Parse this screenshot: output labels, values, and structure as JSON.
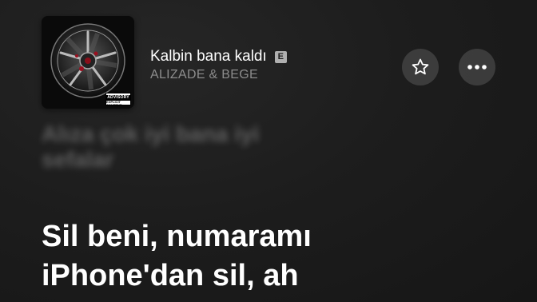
{
  "now_playing": {
    "title": "Kalbin bana kaldı",
    "explicit_badge": "E",
    "artist": "ALIZADE & BEGE",
    "artwork_advisory": {
      "top": "PARENTAL",
      "main": "ADVISORY",
      "bottom": "EXPLICIT CONTENT"
    }
  },
  "actions": {
    "favorite_icon": "star-icon",
    "more_icon": "ellipsis-icon"
  },
  "lyrics": {
    "previous_lines": [
      "Alıza çok iyi bana iyi",
      "sefalar"
    ],
    "current_lines": [
      "Sil beni, numaramı",
      "iPhone'dan sil, ah"
    ]
  },
  "colors": {
    "background": "#1d1d1d",
    "primary_text": "#ffffff",
    "secondary_text": "#8d8d8d",
    "button_fill": "rgba(255,255,255,0.14)"
  }
}
